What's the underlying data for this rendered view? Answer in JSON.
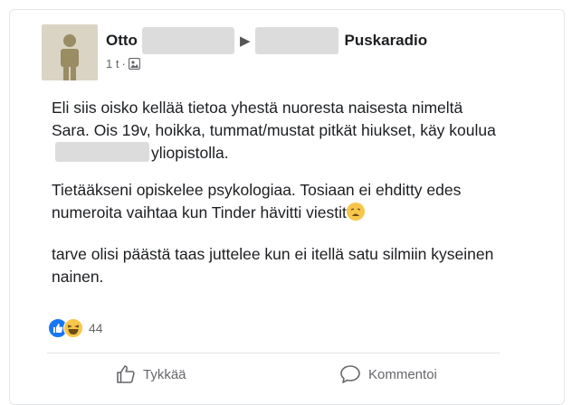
{
  "author": {
    "name": "Otto",
    "group": "Puskaradio",
    "time": "1 t",
    "dot": "·"
  },
  "post": {
    "p1_before": "Eli siis oisko kellää tietoa yhestä nuoresta naisesta nimeltä Sara. Ois 19v, hoikka, tummat/mustat pitkät hiukset, käy koulua",
    "p1_after": "yliopistolla.",
    "p2": "Tietääkseni opiskelee psykologiaa. Tosiaan ei ehditty edes numeroita vaihtaa kun Tinder hävitti viestit",
    "p3": "tarve olisi päästä taas juttelee kun ei itellä satu silmiin kyseinen nainen."
  },
  "reactions": {
    "count": "44",
    "icons": [
      "like-icon",
      "haha-icon"
    ]
  },
  "actions": {
    "like_label": "Tykkää",
    "comment_label": "Kommentoi"
  },
  "colors": {
    "like_blue": "#1877f2",
    "emoji_yellow": "#f7c64b",
    "redaction_gray": "#dcdcdc"
  }
}
